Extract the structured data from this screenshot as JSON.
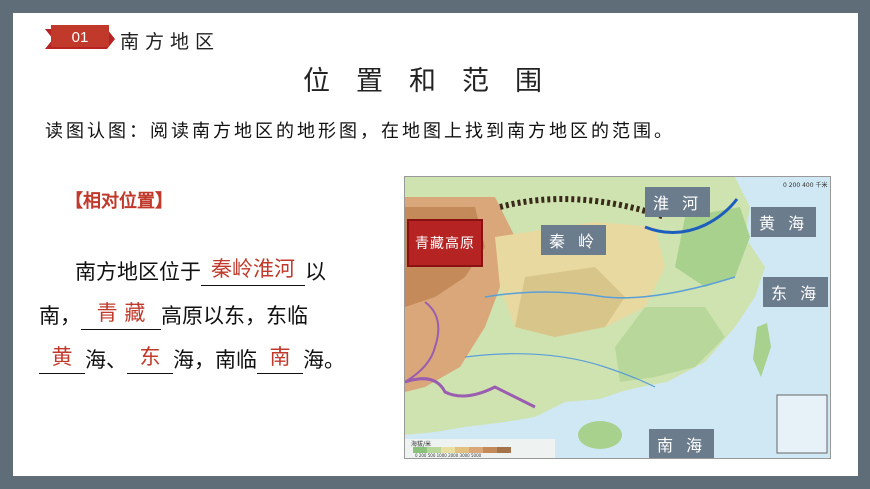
{
  "section": {
    "number": "01",
    "title": "南方地区"
  },
  "main_title": "位置和范围",
  "instruction": "读图认图：阅读南方地区的地形图，在地图上找到南方地区的范围。",
  "subheading": "【相对位置】",
  "lines": {
    "l1_prefix": "南方地区位于",
    "l1_answer": "秦岭淮河",
    "l1_suffix": "以",
    "l2_prefix": "南，",
    "l2_answer": "青  藏",
    "l2_suffix": "高原以东，东临",
    "l3_answer1": "黄",
    "l3_mid1": "海、",
    "l3_answer2": "东",
    "l3_mid2": "海，南临",
    "l3_answer3": "南",
    "l3_suffix": "海。"
  },
  "map_labels": {
    "huaihe": "淮 河",
    "qinling": "秦 岭",
    "huanghai": "黄 海",
    "donghai": "东 海",
    "nanhai": "南 海",
    "qingzang": "青藏高原"
  },
  "map_legend": {
    "title": "海拔/米",
    "ticks": "0 200 500 1000 2000 3000 5000"
  },
  "map_scale": "0 200 400 千米",
  "colors": {
    "accent": "#c0392b",
    "label_bg": "#6b7c8d",
    "frame": "#5f6d79"
  }
}
